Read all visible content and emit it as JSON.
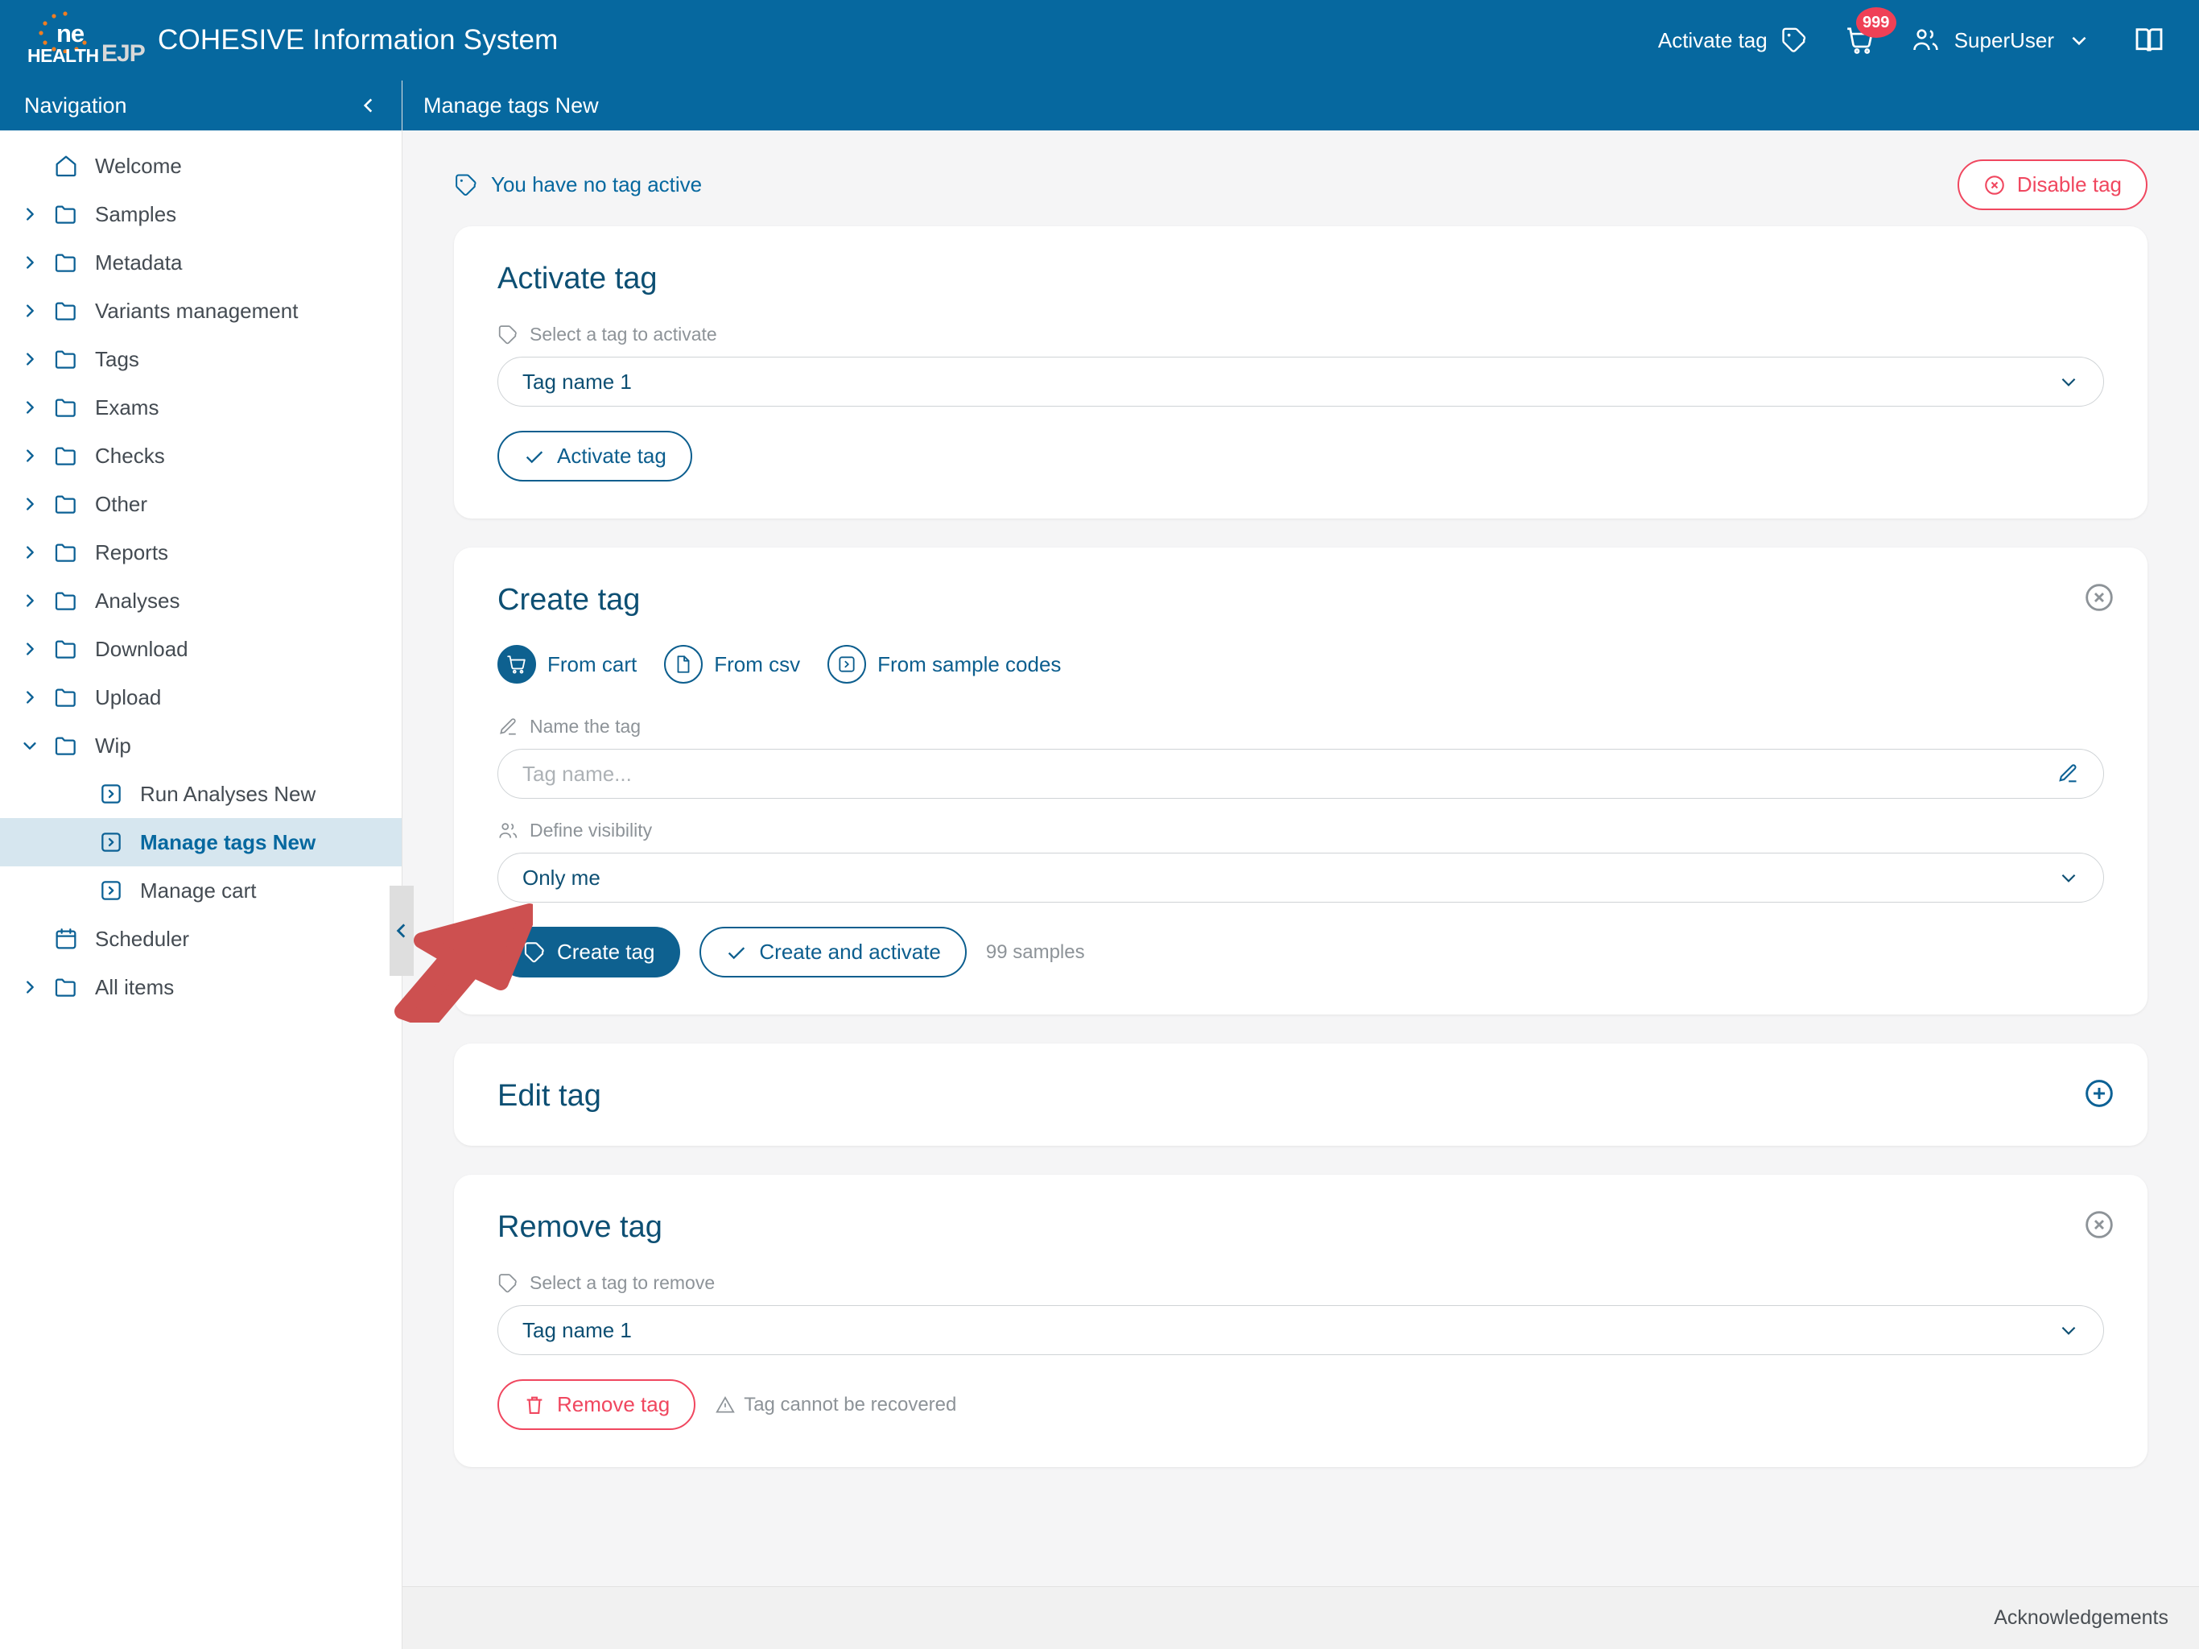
{
  "header": {
    "logo": {
      "one": "ne",
      "health": "HEALTH",
      "ejp": "EJP",
      "alt": "one-health-ejp-logo"
    },
    "app_title": "COHESIVE Information System",
    "activate_tag_label": "Activate tag",
    "cart_badge": "999",
    "user_name": "SuperUser"
  },
  "sidebar": {
    "title": "Navigation",
    "items": [
      {
        "label": "Welcome",
        "icon": "home-icon",
        "expandable": false,
        "level": 0,
        "selected": false
      },
      {
        "label": "Samples",
        "icon": "folder-icon",
        "expandable": true,
        "level": 0,
        "selected": false
      },
      {
        "label": "Metadata",
        "icon": "folder-icon",
        "expandable": true,
        "level": 0,
        "selected": false
      },
      {
        "label": "Variants management",
        "icon": "folder-icon",
        "expandable": true,
        "level": 0,
        "selected": false
      },
      {
        "label": "Tags",
        "icon": "folder-icon",
        "expandable": true,
        "level": 0,
        "selected": false
      },
      {
        "label": "Exams",
        "icon": "folder-icon",
        "expandable": true,
        "level": 0,
        "selected": false
      },
      {
        "label": "Checks",
        "icon": "folder-icon",
        "expandable": true,
        "level": 0,
        "selected": false
      },
      {
        "label": "Other",
        "icon": "folder-icon",
        "expandable": true,
        "level": 0,
        "selected": false
      },
      {
        "label": "Reports",
        "icon": "folder-icon",
        "expandable": true,
        "level": 0,
        "selected": false
      },
      {
        "label": "Analyses",
        "icon": "folder-icon",
        "expandable": true,
        "level": 0,
        "selected": false
      },
      {
        "label": "Download",
        "icon": "folder-icon",
        "expandable": true,
        "level": 0,
        "selected": false
      },
      {
        "label": "Upload",
        "icon": "folder-icon",
        "expandable": true,
        "level": 0,
        "selected": false
      },
      {
        "label": "Wip",
        "icon": "folder-icon",
        "expandable": true,
        "level": 0,
        "selected": false,
        "expanded": true
      },
      {
        "label": "Run Analyses New",
        "icon": "page-arrow-icon",
        "expandable": false,
        "level": 1,
        "selected": false
      },
      {
        "label": "Manage tags New",
        "icon": "page-arrow-icon",
        "expandable": false,
        "level": 1,
        "selected": true
      },
      {
        "label": "Manage cart",
        "icon": "page-arrow-icon",
        "expandable": false,
        "level": 1,
        "selected": false
      },
      {
        "label": "Scheduler",
        "icon": "calendar-icon",
        "expandable": false,
        "level": 0,
        "selected": false
      },
      {
        "label": "All items",
        "icon": "folder-icon",
        "expandable": true,
        "level": 0,
        "selected": false
      }
    ]
  },
  "page": {
    "title": "Manage tags New",
    "status_text": "You have no tag active",
    "disable_tag_label": "Disable tag"
  },
  "activate_card": {
    "title": "Activate tag",
    "select_label": "Select a tag to activate",
    "selected_tag": "Tag name 1",
    "button_label": "Activate tag"
  },
  "create_card": {
    "title": "Create tag",
    "sources": [
      {
        "label": "From cart",
        "icon": "cart-icon",
        "active": true
      },
      {
        "label": "From csv",
        "icon": "file-icon",
        "active": false
      },
      {
        "label": "From sample codes",
        "icon": "page-arrow-icon",
        "active": false
      }
    ],
    "name_label": "Name the tag",
    "name_value": "",
    "name_placeholder": "Tag name...",
    "visibility_label": "Define visibility",
    "visibility_value": "Only me",
    "create_label": "Create tag",
    "create_activate_label": "Create and activate",
    "samples_count": "99 samples"
  },
  "edit_card": {
    "title": "Edit tag"
  },
  "remove_card": {
    "title": "Remove tag",
    "select_label": "Select a tag to remove",
    "selected_tag": "Tag name 1",
    "button_label": "Remove tag",
    "warning": "Tag cannot be recovered"
  },
  "footer": {
    "acknowledgements": "Acknowledgements"
  },
  "colors": {
    "brand_blue": "#06689f",
    "title_blue": "#0d4f73",
    "danger_red": "#f0475f",
    "badge_red": "#ef4056",
    "muted_gray": "#8d9398",
    "selected_bg": "#d6e6ef",
    "cursor_red": "#cd5050"
  }
}
